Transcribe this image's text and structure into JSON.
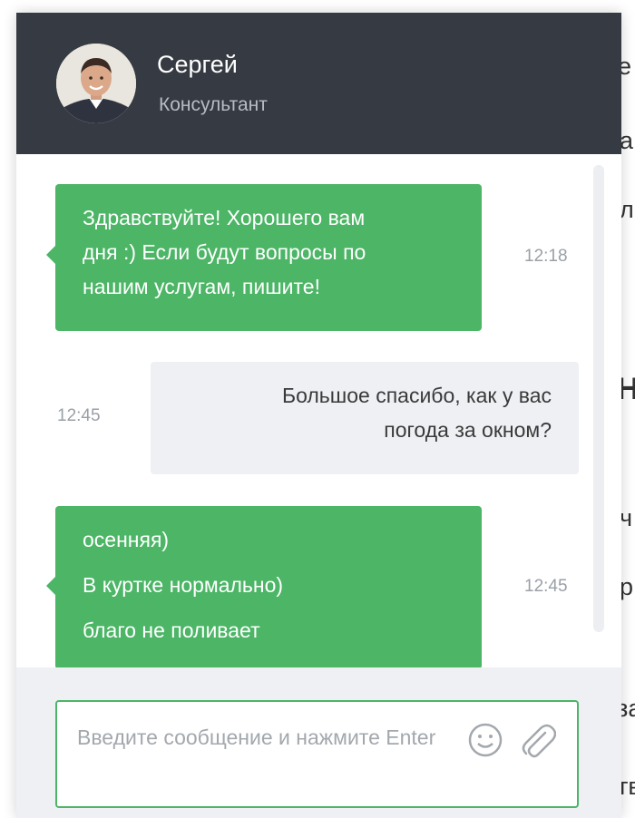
{
  "background_fragments": [
    "е",
    "а",
    "л",
    "Н",
    "ч",
    "р",
    "за",
    "тв"
  ],
  "header": {
    "name": "Сергей",
    "role": "Консультант"
  },
  "messages": [
    {
      "direction": "incoming",
      "lines": [
        "Здравствуйте! Хорошего вам",
        "дня :) Если будут вопросы по",
        "нашим услугам, пишите!"
      ],
      "time": "12:18"
    },
    {
      "direction": "outgoing",
      "lines": [
        "Большое спасибо, как у вас",
        "погода за окном?"
      ],
      "time": "12:45"
    },
    {
      "direction": "incoming",
      "lines": [
        "осенняя)",
        "В куртке нормально)",
        "благо не поливает"
      ],
      "time": "12:45"
    }
  ],
  "composer": {
    "placeholder": "Введите сообщение и нажмите Enter"
  },
  "colors": {
    "header_bg": "#363a42",
    "incoming_bubble": "#4cb566",
    "outgoing_bubble": "#eef0f4",
    "accent": "#4cb566"
  },
  "icons": [
    "smile-icon",
    "paperclip-icon"
  ]
}
